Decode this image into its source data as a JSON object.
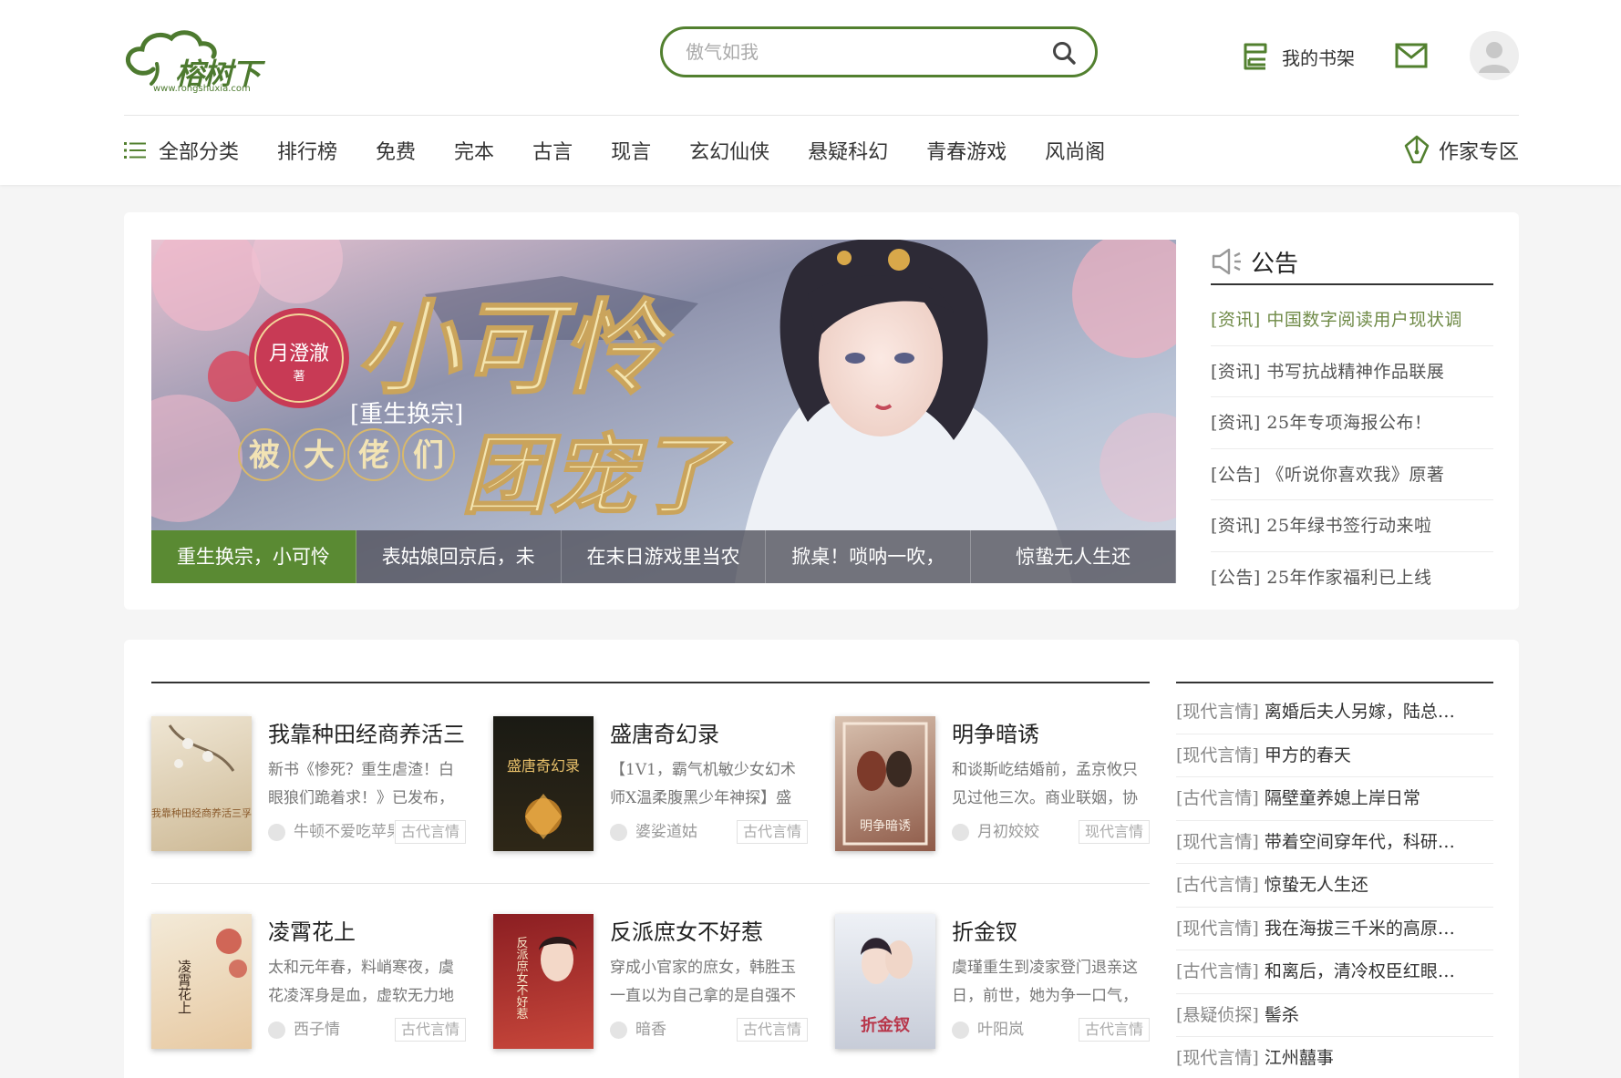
{
  "header": {
    "logo_text": "榕树下",
    "logo_url": "www.rongshuxia.com",
    "search_placeholder": "傲气如我",
    "bookshelf_label": "我的书架"
  },
  "nav": {
    "all_categories": "全部分类",
    "items": [
      "排行榜",
      "免费",
      "完本",
      "古言",
      "现言",
      "玄幻仙侠",
      "悬疑科幻",
      "青春游戏",
      "风尚阁"
    ],
    "author_zone": "作家专区"
  },
  "banner": {
    "tabs": [
      "重生换宗，小可怜",
      "表姑娘回京后，未",
      "在末日游戏里当农",
      "掀桌！唢呐一吹，",
      "惊蛰无人生还"
    ],
    "art_author": "月澄澈",
    "art_author_suffix": "著",
    "art_title": "小可怜",
    "art_subtitle": "[重生换宗]",
    "art_line": [
      "被",
      "大",
      "佬",
      "们"
    ],
    "art_title2": "团宠了"
  },
  "notice": {
    "title": "公告",
    "items": [
      "[资讯] 中国数字阅读用户现状调",
      "[资讯] 书写抗战精神作品联展",
      "[资讯] 25年专项海报公布！",
      "[公告] 《听说你喜欢我》原著",
      "[资讯] 25年绿书签行动来啦",
      "[公告] 25年作家福利已上线"
    ]
  },
  "books": [
    {
      "title": "我靠种田经商养活三",
      "desc": "新书《惨死？重生虐渣！白眼狼们跪着求！》已发布，",
      "author": "牛顿不爱吃苹果",
      "genre": "古代言情",
      "cover_text": "我靠种田经商养活三孚"
    },
    {
      "title": "盛唐奇幻录",
      "desc": "【1V1，霸气机敏少女幻术师X温柔腹黑少年神探】盛",
      "author": "婆娑道姑",
      "genre": "古代言情",
      "cover_text": "盛唐奇幻录"
    },
    {
      "title": "明争暗诱",
      "desc": "和谈斯屹结婚前，孟京攸只见过他三次。商业联姻，协",
      "author": "月初姣姣",
      "genre": "现代言情",
      "cover_text": "明争暗诱"
    },
    {
      "title": "凌霄花上",
      "desc": "太和元年春，料峭寒夜，虞花凌浑身是血，虚软无力地",
      "author": "西子情",
      "genre": "古代言情",
      "cover_text": "凌霄花上"
    },
    {
      "title": "反派庶女不好惹",
      "desc": "穿成小官家的庶女，韩胜玉一直以为自己拿的是自强不",
      "author": "暗香",
      "genre": "古代言情",
      "cover_text": "反派庶女不好惹"
    },
    {
      "title": "折金钗",
      "desc": "虞瑾重生到凌家登门退亲这日，前世，她为争一口气，",
      "author": "叶阳岚",
      "genre": "古代言情",
      "cover_text": "折金钗"
    }
  ],
  "side_list": [
    {
      "tag": "[现代言情]",
      "title": "离婚后夫人另嫁，陆总…"
    },
    {
      "tag": "[现代言情]",
      "title": "甲方的春天"
    },
    {
      "tag": "[古代言情]",
      "title": "隔壁童养媳上岸日常"
    },
    {
      "tag": "[现代言情]",
      "title": "带着空间穿年代，科研…"
    },
    {
      "tag": "[古代言情]",
      "title": "惊蛰无人生还"
    },
    {
      "tag": "[现代言情]",
      "title": "我在海拔三千米的高原…"
    },
    {
      "tag": "[古代言情]",
      "title": "和离后，清冷权臣红眼…"
    },
    {
      "tag": "[悬疑侦探]",
      "title": "髻杀"
    },
    {
      "tag": "[现代言情]",
      "title": "江州囍事"
    }
  ],
  "colors": {
    "brand": "#52802f",
    "brand_active": "#5a8a33",
    "notice_first": "#6f8a47"
  }
}
